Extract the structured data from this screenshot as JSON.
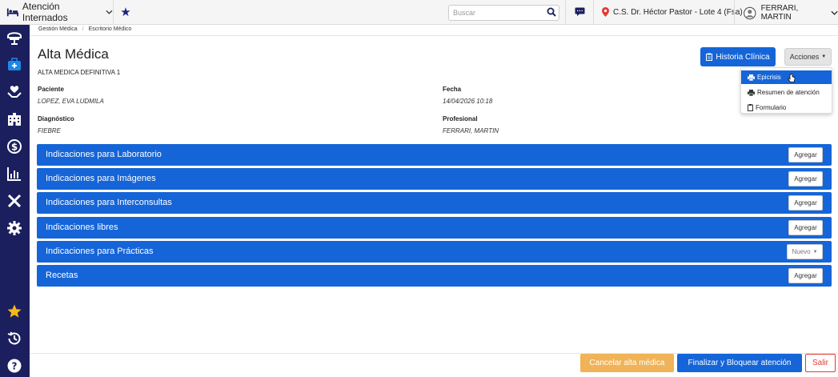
{
  "topbar": {
    "module_label": "Atención Internados",
    "search_placeholder": "Buscar",
    "location": "C.S. Dr. Héctor Pastor - Lote 4 (Fsa)",
    "user_name": "FERRARI, MARTIN"
  },
  "sidebar": {
    "icons": [
      "dashboard-icon",
      "medical-case-icon",
      "care-hands-icon",
      "hospital-icon",
      "billing-icon",
      "reports-chart-icon",
      "tools-icon",
      "settings-icon",
      "favorites-star-icon",
      "history-icon",
      "help-icon"
    ]
  },
  "breadcrumb": [
    "Gestión Médica",
    "Escritorio Médico"
  ],
  "page": {
    "title": "Alta Médica",
    "subtitle": "ALTA MEDICA DEFINITIVA 1"
  },
  "actions": {
    "historia_label": "Historia Clínica",
    "acciones_label": "Acciones",
    "menu": [
      "Epicrisis",
      "Resumen de atención",
      "Formulario"
    ]
  },
  "info": {
    "paciente_label": "Paciente",
    "paciente_value": "LOPEZ, EVA LUDMILA",
    "fecha_label": "Fecha",
    "fecha_value": "14/04/2026 10:18",
    "diagnostico_label": "Diagnóstico",
    "diagnostico_value": "FIEBRE",
    "profesional_label": "Profesional",
    "profesional_value": "FERRARI, MARTIN"
  },
  "sections": [
    {
      "label": "Indicaciones para Laboratorio",
      "button": "Agregar"
    },
    {
      "label": "Indicaciones para Imágenes",
      "button": "Agregar"
    },
    {
      "label": "Indicaciones para Interconsultas",
      "button": "Agregar"
    },
    {
      "label": "Indicaciones libres",
      "button": "Agregar"
    },
    {
      "label": "Indicaciones para Prácticas",
      "button": "Nuevo"
    },
    {
      "label": "Recetas",
      "button": "Agregar"
    }
  ],
  "footer": {
    "cancel_label": "Cancelar alta médica",
    "finalize_label": "Finalizar y Bloquear atención",
    "exit_label": "Salir"
  },
  "colors": {
    "primary": "#1565d8",
    "sidebar": "#1b1f5e",
    "warning": "#f0b358",
    "danger": "#e53935"
  }
}
